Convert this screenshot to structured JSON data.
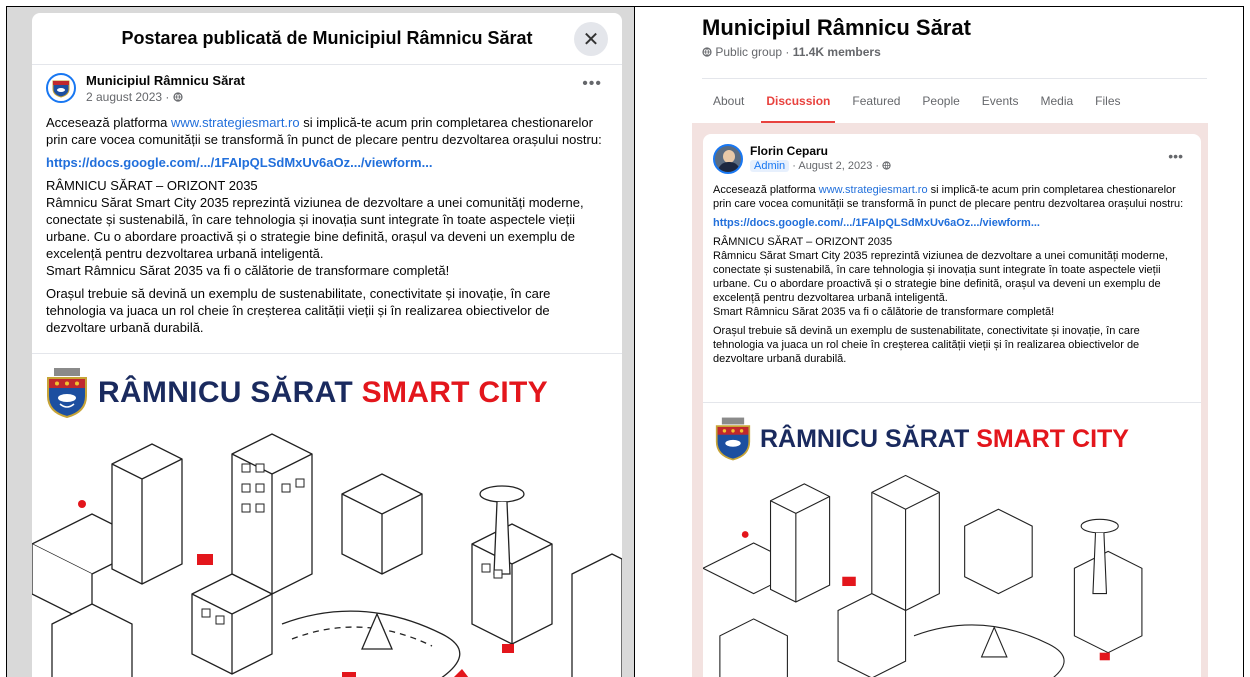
{
  "modal": {
    "title": "Postarea publicată de Municipiul Râmnicu Sărat",
    "close_glyph": "✕",
    "post": {
      "author": "Municipiul Râmnicu Sărat",
      "date": "2 august 2023 · ",
      "privacy_icon": "globe-icon",
      "more_glyph": "•••",
      "p1_prefix": "Accesează platforma ",
      "p1_link": "www.strategiesmart.ro",
      "p1_suffix": " si implică-te acum prin completarea chestionarelor prin care vocea comunității se transformă în punct de plecare pentru dezvoltarea orașului nostru:",
      "form_link": "https://docs.google.com/.../1FAIpQLSdMxUv6aOz.../viewform...",
      "heading": "RÂMNICU SĂRAT – ORIZONT 2035",
      "p2": "Râmnicu Sărat Smart City 2035 reprezintă viziunea de dezvoltare a unei comunități moderne, conectate și sustenabilă, în care tehnologia și inovația sunt integrate în toate aspectele vieții urbane. Cu o abordare proactivă și o strategie bine definită, orașul va deveni un exemplu de excelență pentru dezvoltarea urbană inteligentă.",
      "p3": "Smart Râmnicu Sărat  2035 va fi o călătorie de transformare completă!",
      "p4": "Orașul trebuie să devină un exemplu de sustenabilitate, conectivitate și inovație, în care tehnologia va juaca un rol cheie în creșterea calității vieții și în realizarea obiectivelor de dezvoltare urbană durabilă."
    }
  },
  "banner": {
    "blue_text": "RÂMNICU SĂRAT",
    "red_text": "SMART CITY"
  },
  "group": {
    "name": "Municipiul Râmnicu Sărat",
    "privacy": "Public group · ",
    "members": "11.4K members",
    "tabs": [
      "About",
      "Discussion",
      "Featured",
      "People",
      "Events",
      "Media",
      "Files"
    ],
    "active_tab": "Discussion"
  },
  "group_post": {
    "author": "Florin Ceparu",
    "badge": "Admin",
    "date": " · August 2, 2023 · ",
    "more_glyph": "•••",
    "p1_prefix": "Accesează platforma ",
    "p1_link": "www.strategiesmart.ro",
    "p1_suffix": " si implică-te acum prin completarea chestionarelor prin care vocea comunității se transformă în punct de plecare pentru dezvoltarea orașului nostru:",
    "form_link": "https://docs.google.com/.../1FAIpQLSdMxUv6aOz.../viewform...",
    "heading": "RÂMNICU SĂRAT – ORIZONT 2035",
    "p2": "Râmnicu Sărat Smart City 2035 reprezintă viziunea de dezvoltare a unei comunități moderne, conectate și sustenabilă, în care tehnologia și inovația sunt integrate în toate aspectele vieții urbane. Cu o abordare proactivă și o strategie bine definită, orașul va deveni un exemplu de excelență pentru dezvoltarea urbană inteligentă.",
    "p3": "Smart Râmnicu Sărat  2035 va fi o călătorie de transformare completă!",
    "p4": "Orașul trebuie să devină un exemplu de sustenabilitate, conectivitate și inovație, în care tehnologia va juaca un rol cheie în creșterea calității vieții și în realizarea obiectivelor de dezvoltare urbană durabilă."
  },
  "colors": {
    "accent_red": "#e8423e",
    "link_blue": "#216fdb",
    "banner_blue": "#1a2a5e",
    "banner_red": "#e3161c"
  }
}
